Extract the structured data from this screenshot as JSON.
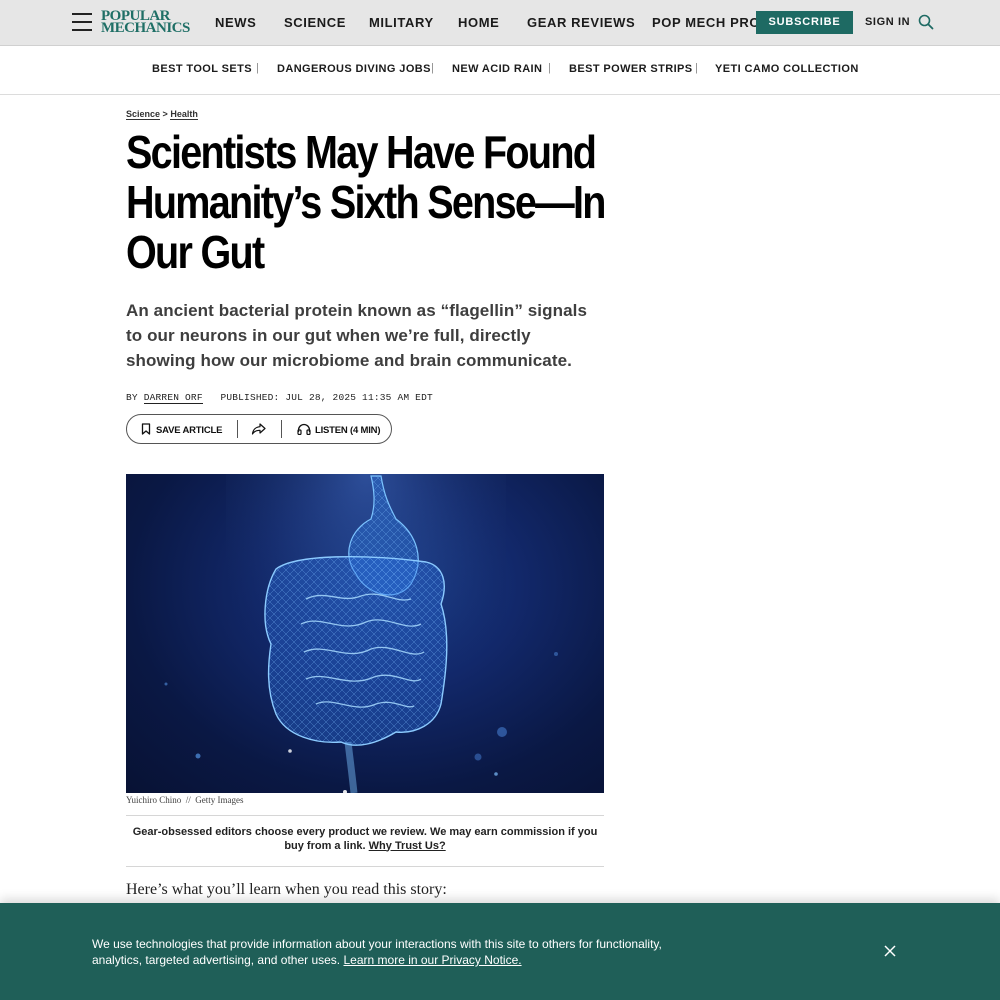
{
  "header": {
    "logo_line1": "POPULAR",
    "logo_line2": "MECHANICS",
    "nav": [
      "NEWS",
      "SCIENCE",
      "MILITARY",
      "HOME",
      "GEAR REVIEWS",
      "POP MECH PRO"
    ],
    "subscribe_label": "SUBSCRIBE",
    "signin_label": "SIGN IN",
    "menu_icon": "hamburger-menu-icon",
    "search_icon": "search-icon"
  },
  "trending": {
    "items": [
      "BEST TOOL SETS",
      "DANGEROUS DIVING JOBS",
      "NEW ACID RAIN",
      "BEST POWER STRIPS",
      "YETI CAMO COLLECTION"
    ],
    "separator": "|"
  },
  "article": {
    "breadcrumb": [
      "Science",
      "Health"
    ],
    "breadcrumb_sep": ">",
    "headline": "Scientists May Have Found Humanity’s Sixth Sense—In Our Gut",
    "dek": "An ancient bacterial protein known as “flagellin” signals to our neurons in our gut when we’re full, directly showing how our microbiome and brain communicate.",
    "by_label": "BY",
    "author": "DARREN ORF",
    "published": "PUBLISHED: JUL 28, 2025 11:35 AM EDT",
    "save_label": "SAVE ARTICLE",
    "listen_label": "LISTEN (4 MIN)",
    "image_credit": "Yuichiro Chino",
    "image_source": "Getty Images",
    "credit_sep": "//",
    "disclaimer": "Gear-obsessed editors choose every product we review. We may earn commission if you buy from a link.",
    "trust_link": "Why Trust Us?",
    "learn_intro": "Here’s what you’ll learn when you read this story:"
  },
  "cookie": {
    "text": "We use technologies that provide information about your interactions with this site to others for functionality, analytics, targeted advertising, and other uses.",
    "link": "Learn more in our Privacy Notice."
  },
  "colors": {
    "brand_green": "#1e6a63",
    "banner_green": "#1f5f58",
    "topbar_gray": "#e6e6e6"
  }
}
